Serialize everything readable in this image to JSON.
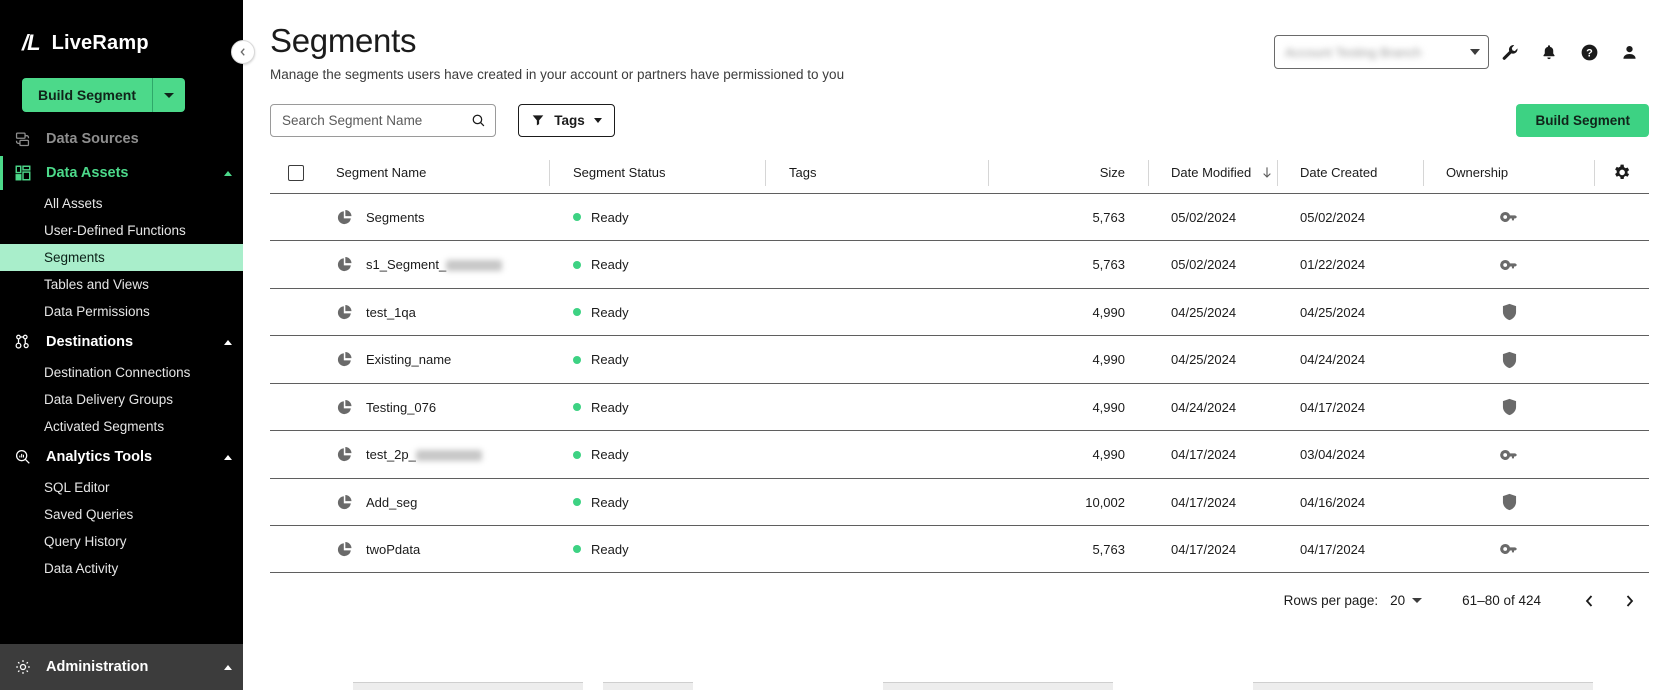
{
  "brand": {
    "logo": "/L",
    "name": "LiveRamp"
  },
  "sidebar": {
    "build_button": {
      "label": "Build Segment",
      "caret_icon": "caret-down-icon"
    },
    "groups": [
      {
        "label": "Data Sources",
        "icon": "database-icon",
        "active": false,
        "expanded": false,
        "items": []
      },
      {
        "label": "Data Assets",
        "icon": "data-assets-icon",
        "active": true,
        "expanded": true,
        "items": [
          "All Assets",
          "User-Defined Functions",
          "Segments",
          "Tables and Views",
          "Data Permissions"
        ]
      },
      {
        "label": "Destinations",
        "icon": "destinations-icon",
        "active": false,
        "expanded": true,
        "items": [
          "Destination Connections",
          "Data Delivery Groups",
          "Activated Segments"
        ]
      },
      {
        "label": "Analytics Tools",
        "icon": "analytics-icon",
        "active": false,
        "expanded": true,
        "items": [
          "SQL Editor",
          "Saved Queries",
          "Query History",
          "Data Activity"
        ]
      }
    ],
    "selected_item": "Segments",
    "administration": {
      "label": "Administration",
      "icon": "gear-icon"
    },
    "collapse_icon": "chevron-left-icon"
  },
  "header": {
    "title": "Segments",
    "subtitle": "Manage the segments users have created in your account or partners have permissioned to you",
    "account_selector": {
      "value": "",
      "redacted": true,
      "caret_icon": "caret-down-icon"
    },
    "icons": [
      "wrench-icon",
      "bell-icon",
      "help-circle-icon",
      "user-icon"
    ]
  },
  "toolbar": {
    "search": {
      "placeholder": "Search Segment Name",
      "value": "",
      "icon": "search-icon"
    },
    "tags_filter": {
      "label": "Tags",
      "icon": "filter-icon",
      "caret_icon": "caret-down-icon"
    },
    "build_segment_cta": "Build Segment",
    "accent_color": "#3dd283"
  },
  "table": {
    "select_all_checked": false,
    "settings_icon": "gear-icon",
    "columns": [
      {
        "key": "name",
        "label": "Segment Name"
      },
      {
        "key": "status",
        "label": "Segment Status"
      },
      {
        "key": "tags",
        "label": "Tags"
      },
      {
        "key": "size",
        "label": "Size"
      },
      {
        "key": "date_modified",
        "label": "Date Modified",
        "sorted": "desc",
        "sort_icon": "arrow-down-icon"
      },
      {
        "key": "date_created",
        "label": "Date Created"
      },
      {
        "key": "ownership",
        "label": "Ownership"
      }
    ],
    "rows": [
      {
        "icon": "pie-chart-icon",
        "name": "Segments",
        "name_redacted": false,
        "status": "Ready",
        "tags": "",
        "size": "5,763",
        "date_modified": "05/02/2024",
        "date_created": "05/02/2024",
        "ownership_icon": "key-icon"
      },
      {
        "icon": "pie-chart-icon",
        "name": "s1_Segment_",
        "name_redacted": true,
        "redact_width": 56,
        "status": "Ready",
        "tags": "",
        "size": "5,763",
        "date_modified": "05/02/2024",
        "date_created": "01/22/2024",
        "ownership_icon": "key-icon"
      },
      {
        "icon": "pie-chart-icon",
        "name": "test_1qa",
        "name_redacted": false,
        "status": "Ready",
        "tags": "",
        "size": "4,990",
        "date_modified": "04/25/2024",
        "date_created": "04/25/2024",
        "ownership_icon": "shield-icon"
      },
      {
        "icon": "pie-chart-icon",
        "name": "Existing_name",
        "name_redacted": false,
        "status": "Ready",
        "tags": "",
        "size": "4,990",
        "date_modified": "04/25/2024",
        "date_created": "04/24/2024",
        "ownership_icon": "shield-icon"
      },
      {
        "icon": "pie-chart-icon",
        "name": "Testing_076",
        "name_redacted": false,
        "status": "Ready",
        "tags": "",
        "size": "4,990",
        "date_modified": "04/24/2024",
        "date_created": "04/17/2024",
        "ownership_icon": "shield-icon"
      },
      {
        "icon": "pie-chart-icon",
        "name": "test_2p_",
        "name_redacted": true,
        "redact_width": 66,
        "status": "Ready",
        "tags": "",
        "size": "4,990",
        "date_modified": "04/17/2024",
        "date_created": "03/04/2024",
        "ownership_icon": "key-icon"
      },
      {
        "icon": "pie-chart-icon",
        "name": "Add_seg",
        "name_redacted": false,
        "status": "Ready",
        "tags": "",
        "size": "10,002",
        "date_modified": "04/17/2024",
        "date_created": "04/16/2024",
        "ownership_icon": "shield-icon"
      },
      {
        "icon": "pie-chart-icon",
        "name": "twoPdata",
        "name_redacted": false,
        "status": "Ready",
        "tags": "",
        "size": "5,763",
        "date_modified": "04/17/2024",
        "date_created": "04/17/2024",
        "ownership_icon": "key-icon"
      }
    ]
  },
  "pagination": {
    "rows_per_page_label": "Rows per page:",
    "rows_per_page_value": "20",
    "range": "61–80 of 424",
    "prev_icon": "chevron-left-icon",
    "next_icon": "chevron-right-icon"
  }
}
